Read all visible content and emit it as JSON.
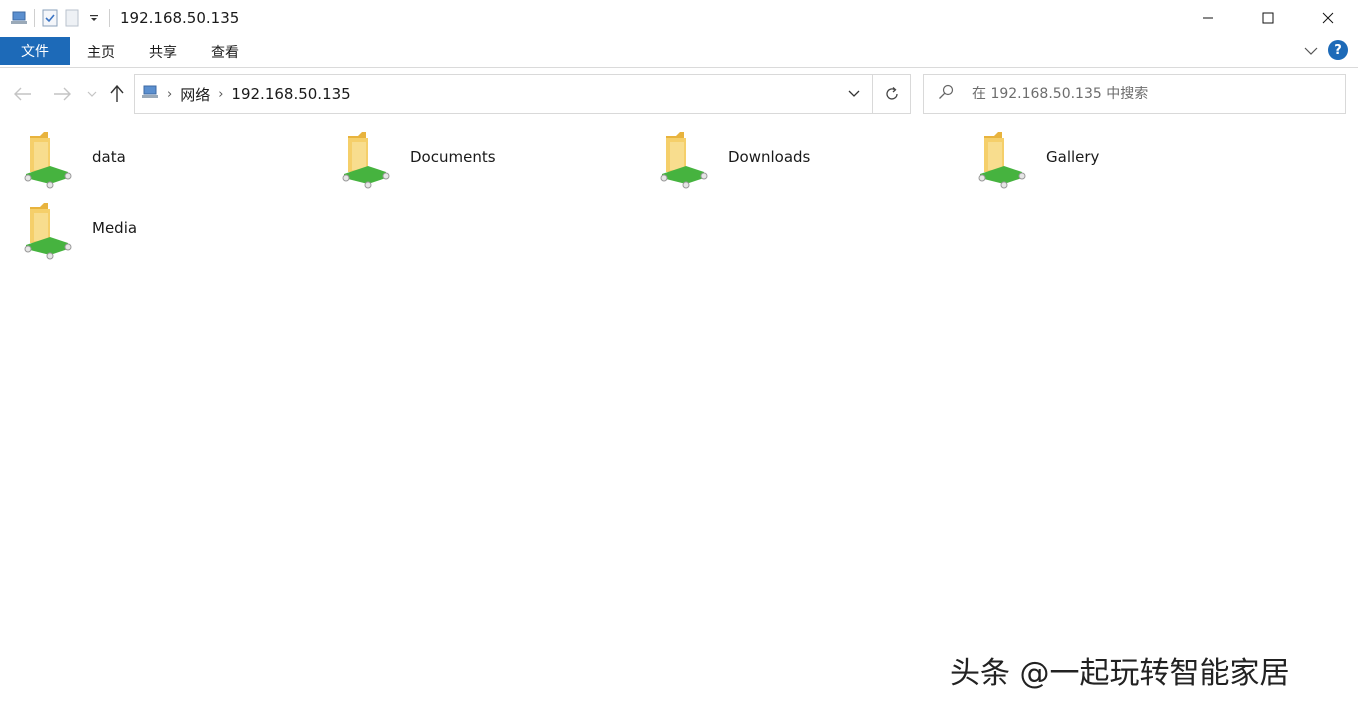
{
  "window": {
    "title": "192.168.50.135"
  },
  "ribbon": {
    "tabs": [
      {
        "label": "文件"
      },
      {
        "label": "主页"
      },
      {
        "label": "共享"
      },
      {
        "label": "查看"
      }
    ],
    "help_label": "?"
  },
  "address_bar": {
    "crumbs": [
      {
        "label": "网络"
      },
      {
        "label": "192.168.50.135"
      }
    ]
  },
  "search": {
    "placeholder": "在 192.168.50.135 中搜索"
  },
  "items": [
    {
      "label": "data",
      "icon": "network-share-folder-icon"
    },
    {
      "label": "Documents",
      "icon": "network-share-folder-icon"
    },
    {
      "label": "Downloads",
      "icon": "network-share-folder-icon"
    },
    {
      "label": "Gallery",
      "icon": "network-share-folder-icon"
    },
    {
      "label": "Media",
      "icon": "network-share-folder-icon"
    }
  ],
  "watermark": {
    "text": "头条 @一起玩转智能家居"
  },
  "colors": {
    "accent": "#1d6ab8",
    "folder": "#f2c85a",
    "share_pipe": "#3aa534"
  }
}
